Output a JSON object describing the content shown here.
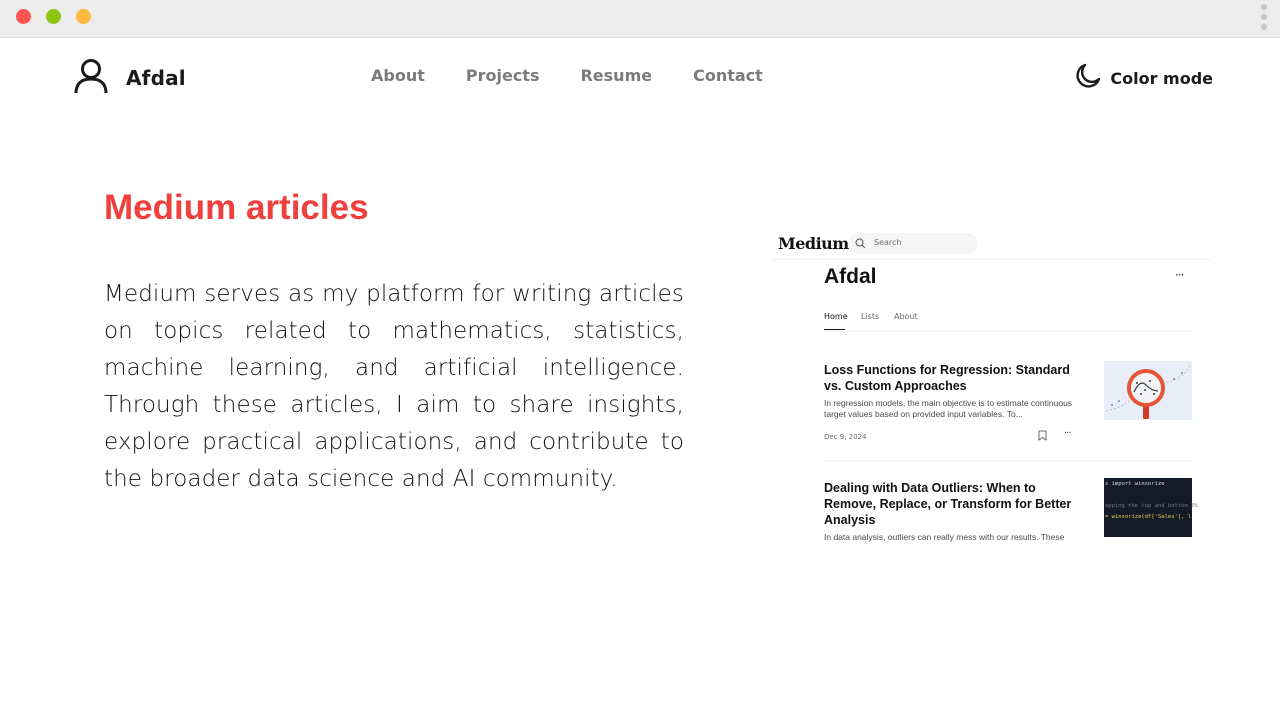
{
  "window": {
    "controls": [
      "close",
      "minimize",
      "maximize"
    ],
    "menu_icon": "kebab-vertical-icon"
  },
  "nav": {
    "brand_icon": "user-icon",
    "brand_name": "Afdal",
    "links": [
      "About",
      "Projects",
      "Resume",
      "Contact"
    ],
    "color_mode_icon": "moon-icon",
    "color_mode_label": "Color mode"
  },
  "section": {
    "title": "Medium articles",
    "description": "Medium serves as my platform for writing articles on topics related to mathematics, statistics, machine learning, and artificial intelligence. Through these articles, I aim to share insights, explore practical applications, and contribute to the broader data science and AI community."
  },
  "medium_screenshot": {
    "logo": "Medium",
    "search_placeholder": "Search",
    "profile_name": "Afdal",
    "more": "···",
    "tabs": [
      "Home",
      "Lists",
      "About"
    ],
    "active_tab": "Home",
    "articles": [
      {
        "title": "Loss Functions for Regression: Standard vs. Custom Approaches",
        "excerpt": "In regression models, the main objective is to estimate continuous target values based on provided input variables. To...",
        "date": "Dec 9, 2024",
        "thumbnail": "magnifier-chart-thumbnail"
      },
      {
        "title": "Dealing with Data Outliers: When to Remove, Replace, or Transform for Better Analysis",
        "excerpt": "In data analysis, outliers can really mess with our results. These",
        "thumbnail": "code-thumbnail",
        "code_lines": [
          "s import winsorize",
          "apping the top and bottom 5%",
          "= winsorize(df['Sales'], l"
        ]
      }
    ]
  },
  "colors": {
    "accent": "#f0403e",
    "nav_link": "#7b7b7b",
    "text": "#111111"
  }
}
